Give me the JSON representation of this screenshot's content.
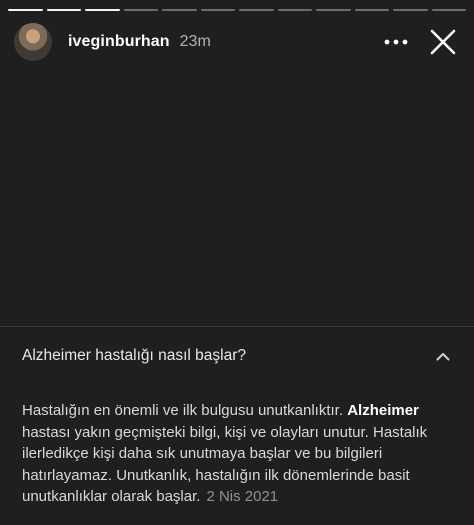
{
  "story": {
    "progress_total": 12,
    "progress_done": 3
  },
  "header": {
    "username": "iveginburhan",
    "time": "23m",
    "more_icon": "more-horizontal-icon",
    "close_icon": "close-icon"
  },
  "faq": {
    "question": "Alzheimer hastalığı nasıl başlar?",
    "expanded": true,
    "answer_part1": "Hastalığın en önemli ve ilk bulgusu unutkanlıktır. ",
    "answer_bold": "Alzheimer",
    "answer_part2": " hastası yakın geçmişteki bilgi, kişi ve olayları unutur. Hastalık ilerledikçe kişi daha sık unutmaya başlar ve bu bilgileri hatırlayamaz. Unutkanlık, hastalığın ilk dönemlerinde basit unutkanlıklar olarak başlar.",
    "date": "2 Nis 2021"
  }
}
